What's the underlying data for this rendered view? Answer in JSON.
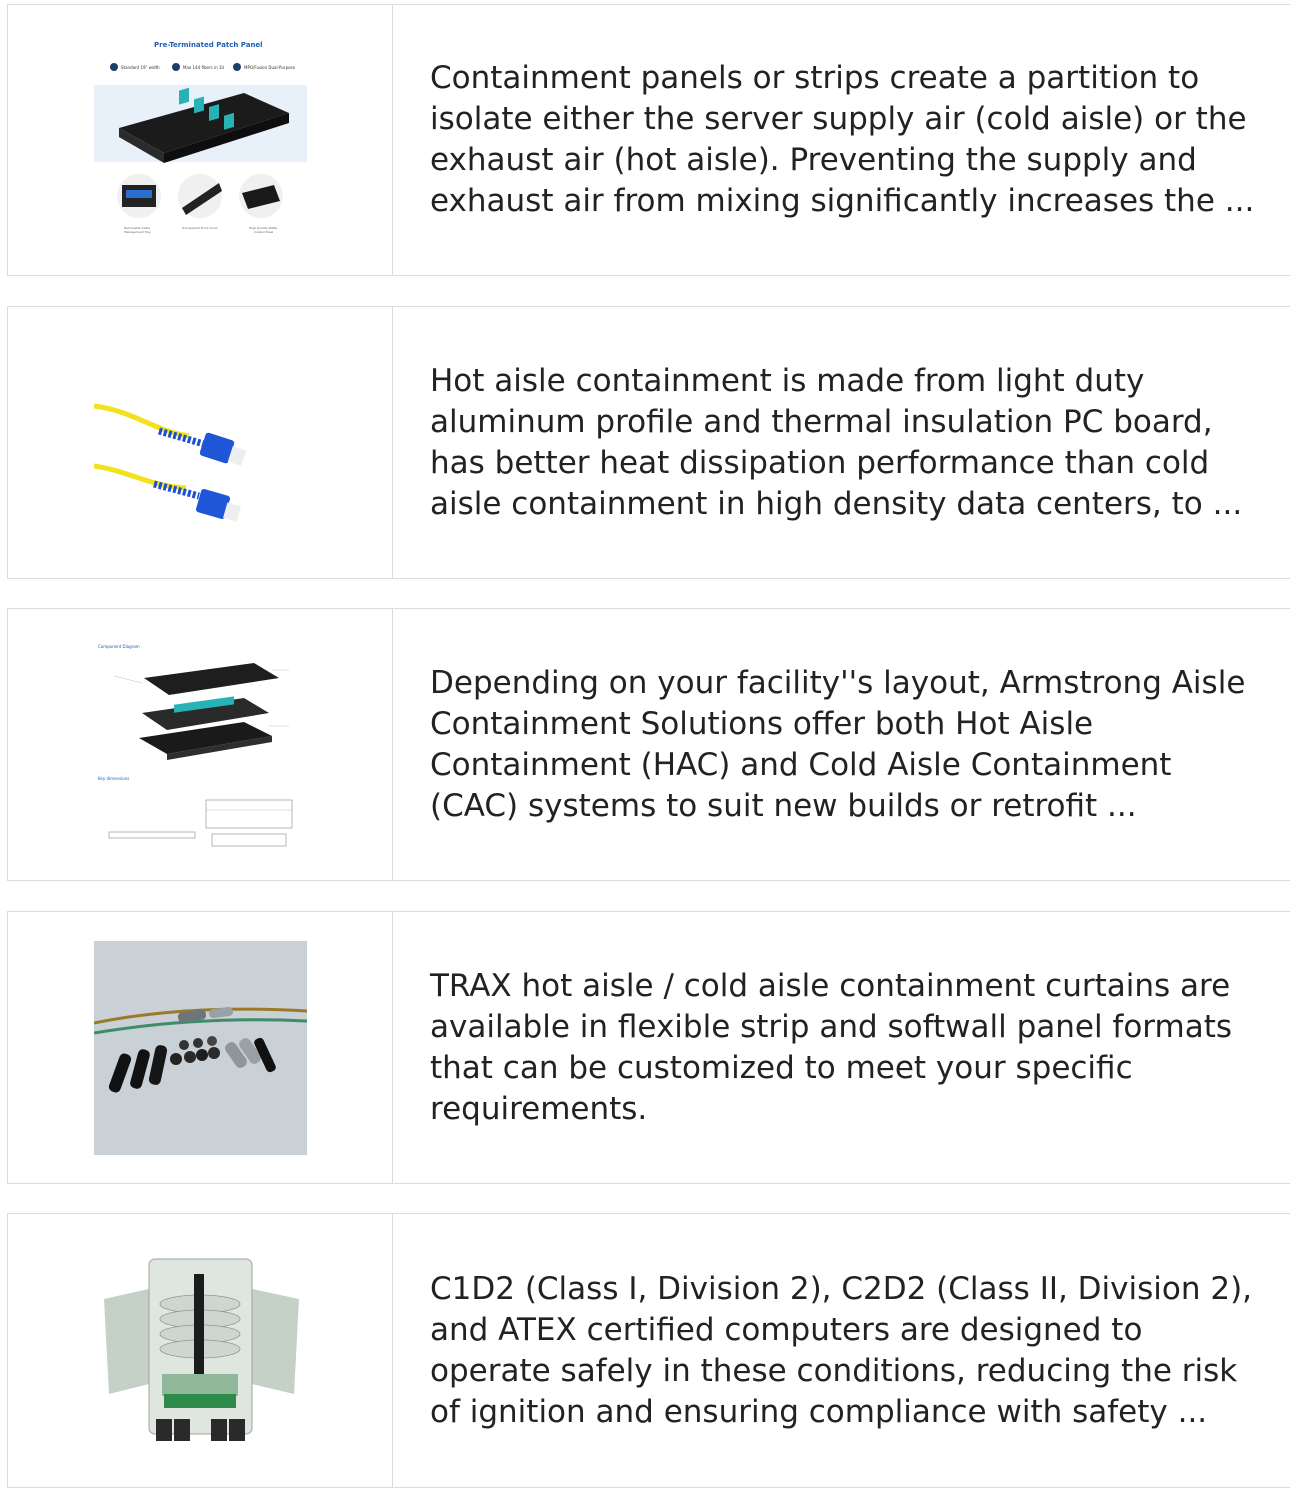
{
  "items": [
    {
      "image_name": "pre-terminated-patch-panel-image",
      "image_text": {
        "title": "Pre-Terminated Patch Panel",
        "f1": "Standard 19\" width",
        "f2": "Max 144 fibers in 1U",
        "f3": "MPO/Fusion Dual-Purpose"
      },
      "description": "Containment panels or strips create a partition to isolate either the server supply air (cold aisle) or the exhaust air (hot aisle). Preventing the supply and exhaust air from mixing significantly increases the ..."
    },
    {
      "image_name": "sc-fiber-patch-cord-image",
      "description": "Hot aisle containment is made from light duty aluminum profile and thermal insulation PC board, has better heat dissipation performance than cold aisle containment in high density data centers, to ..."
    },
    {
      "image_name": "patch-panel-component-diagram-image",
      "image_text": {
        "title": "Component Diagram",
        "dims": "Key dimensions"
      },
      "description": "Depending on your facility''s layout, Armstrong Aisle Containment Solutions offer both Hot Aisle Containment (HAC) and Cold Aisle Containment (CAC) systems to suit new builds or retrofit ..."
    },
    {
      "image_name": "cable-grommets-image",
      "description": "TRAX hot aisle / cold aisle containment curtains are available in flexible strip and softwall panel formats that can be customized to meet your specific requirements."
    },
    {
      "image_name": "fiber-distribution-box-image",
      "description": "C1D2 (Class I, Division 2), C2D2 (Class II, Division 2), and ATEX certified computers are designed to operate safely in these conditions, reducing the risk of ignition and ensuring compliance with safety ..."
    }
  ]
}
